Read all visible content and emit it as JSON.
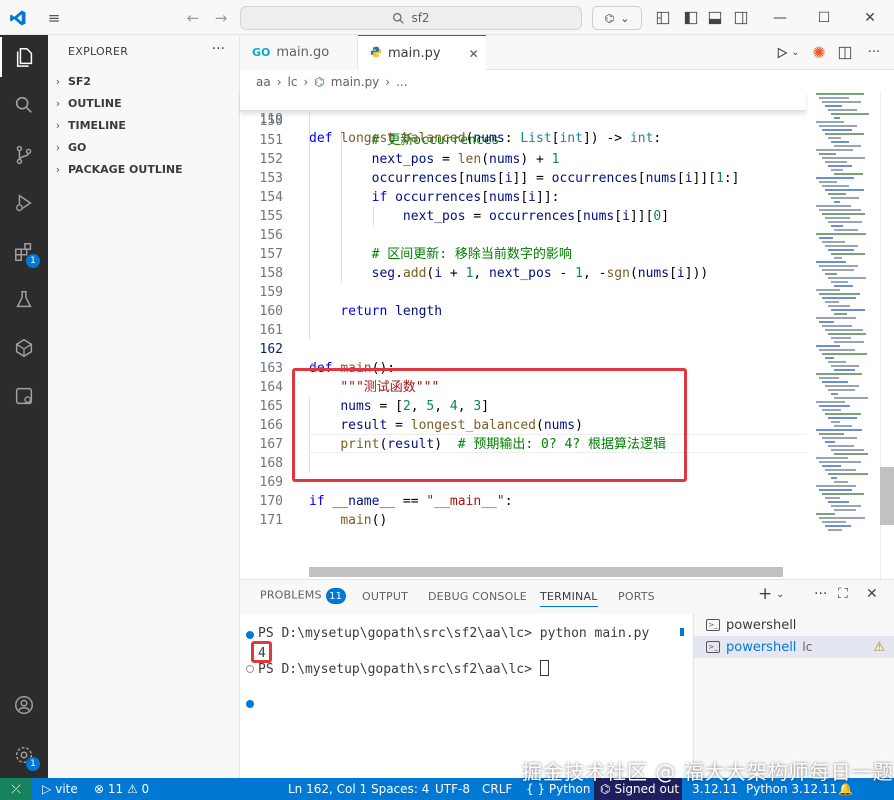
{
  "titlebar": {
    "search_text": "sf2"
  },
  "activity": {
    "extensions_badge": "1",
    "accounts_badge": "1"
  },
  "sidebar": {
    "header": "EXPLORER",
    "more": "···",
    "sections": [
      "SF2",
      "OUTLINE",
      "TIMELINE",
      "GO",
      "PACKAGE OUTLINE"
    ]
  },
  "tabs": {
    "items": [
      {
        "label": "main.go",
        "icon": "GO"
      },
      {
        "label": "main.py",
        "icon": "python-icon"
      }
    ]
  },
  "breadcrumb": {
    "parts": [
      "aa",
      "lc",
      "main.py",
      "..."
    ]
  },
  "editor": {
    "sticky": {
      "num": "119",
      "text": "def longest_balanced(nums: List[int]) -> int:"
    },
    "lines": [
      {
        "num": "150",
        "text": ""
      },
      {
        "num": "151",
        "text": "        # 更新occurrences"
      },
      {
        "num": "152",
        "text": "        next_pos = len(nums) + 1"
      },
      {
        "num": "153",
        "text": "        occurrences[nums[i]] = occurrences[nums[i]][1:]"
      },
      {
        "num": "154",
        "text": "        if occurrences[nums[i]]:"
      },
      {
        "num": "155",
        "text": "            next_pos = occurrences[nums[i]][0]"
      },
      {
        "num": "156",
        "text": ""
      },
      {
        "num": "157",
        "text": "        # 区间更新: 移除当前数字的影响"
      },
      {
        "num": "158",
        "text": "        seg.add(i + 1, next_pos - 1, -sgn(nums[i]))"
      },
      {
        "num": "159",
        "text": ""
      },
      {
        "num": "160",
        "text": "    return length"
      },
      {
        "num": "161",
        "text": ""
      },
      {
        "num": "162",
        "text": ""
      },
      {
        "num": "163",
        "text": "def main():"
      },
      {
        "num": "164",
        "text": "    \"\"\"测试函数\"\"\""
      },
      {
        "num": "165",
        "text": "    nums = [2, 5, 4, 3]"
      },
      {
        "num": "166",
        "text": "    result = longest_balanced(nums)"
      },
      {
        "num": "167",
        "text": "    print(result)  # 预期输出: 0? 4? 根据算法逻辑"
      },
      {
        "num": "168",
        "text": ""
      },
      {
        "num": "169",
        "text": ""
      },
      {
        "num": "170",
        "text": "if __name__ == \"__main__\":"
      },
      {
        "num": "171",
        "text": "    main()"
      }
    ]
  },
  "panel": {
    "tabs": [
      "PROBLEMS",
      "OUTPUT",
      "DEBUG CONSOLE",
      "TERMINAL",
      "PORTS"
    ],
    "problems_badge": "11",
    "terminal": {
      "prompt1": "PS D:\\mysetup\\gopath\\src\\sf2\\aa\\lc> python main.py",
      "output": "4",
      "prompt2": "PS D:\\mysetup\\gopath\\src\\sf2\\aa\\lc> "
    },
    "terminal_list": [
      {
        "name": "powershell",
        "suffix": ""
      },
      {
        "name": "powershell",
        "suffix": "lc"
      }
    ]
  },
  "statusbar": {
    "vite": "vite",
    "problems": "⊗ 11 ⚠ 0",
    "position": "Ln 162, Col 1",
    "spaces": "Spaces: 4",
    "encoding": "UTF-8",
    "eol": "CRLF",
    "language": "{ }  Python",
    "signed_out": "Signed out",
    "version": "3.12.11",
    "interpreter": "Python 3.12.11"
  },
  "watermark": "掘金技术社区 @ 福大大架构师每日一题",
  "colors": {
    "accent": "#0078d4",
    "highlight_box": "#e0383e",
    "statusbar": "#0078d4"
  }
}
